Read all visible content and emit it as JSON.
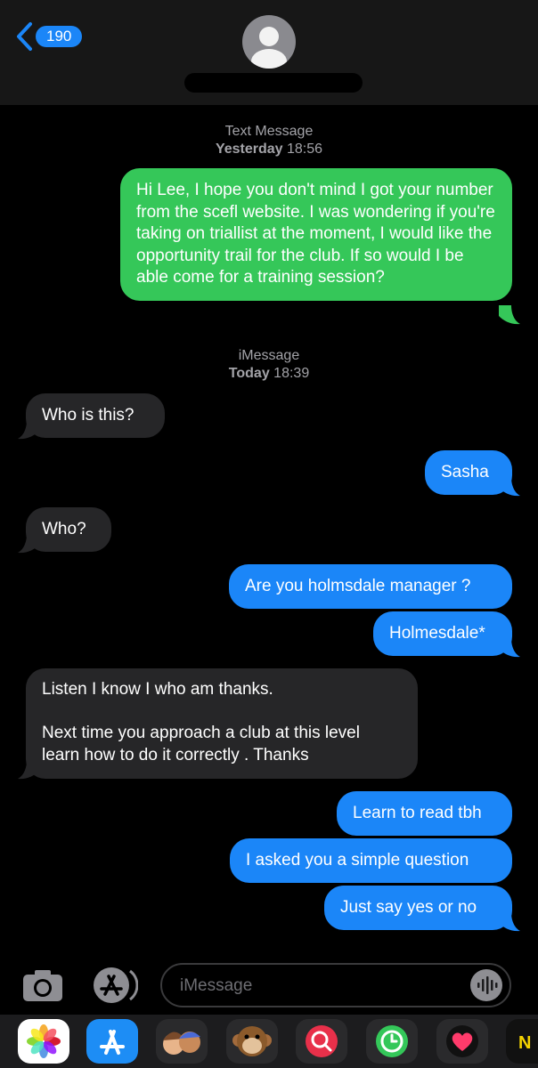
{
  "header": {
    "back_count": "190"
  },
  "stamps": [
    {
      "kind": "Text Message",
      "day": "Yesterday",
      "time": "18:56"
    },
    {
      "kind": "iMessage",
      "day": "Today",
      "time": "18:39"
    }
  ],
  "messages": {
    "m1": "Hi Lee, I hope you don't mind I got your number from the scefl website. I was wondering if you're taking on triallist at the moment, I would like the opportunity trail for the club. If so would I be able come for a training session?",
    "m2": "Who is this?",
    "m3": "Sasha",
    "m4": "Who?",
    "m5": "Are you holmsdale manager ?",
    "m6": "Holmesdale*",
    "m7": "Listen I know I who am thanks.\n\nNext time you approach a club at this level learn how to do it correctly . Thanks",
    "m8": "Learn to read tbh",
    "m9": "I asked you a simple question",
    "m10": "Just say yes or no"
  },
  "composer": {
    "placeholder": "iMessage"
  },
  "icons": {
    "camera": "camera-icon",
    "appstore": "app-store-icon",
    "audio": "audio-waveform-icon",
    "dock": [
      "photos-icon",
      "app-store-icon",
      "memoji-icon",
      "animoji-monkey-icon",
      "search-images-icon",
      "fitness-icon",
      "heart-sticker-icon",
      "nike-icon"
    ]
  },
  "colors": {
    "sms_green": "#35c759",
    "imessage_blue": "#1b86f8",
    "incoming_gray": "#262628"
  }
}
